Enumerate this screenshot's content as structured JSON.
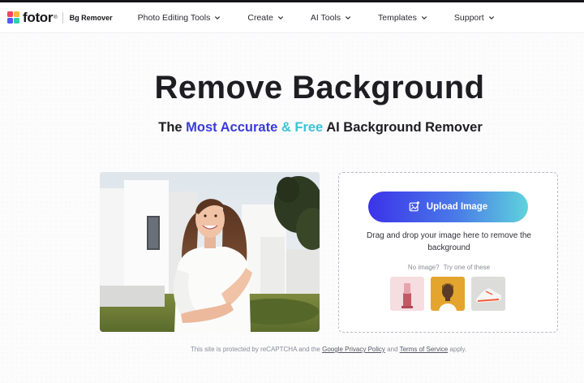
{
  "brand": {
    "logo_text": "fotor",
    "logo_reg": "®",
    "product": "Bg Remover",
    "logo_colors": [
      "#f5455c",
      "#ffb43a",
      "#4f5bff",
      "#2ed3a6"
    ]
  },
  "nav": {
    "items": [
      {
        "label": "Photo Editing Tools",
        "icon": "chevron-down-icon"
      },
      {
        "label": "Create",
        "icon": "chevron-down-icon"
      },
      {
        "label": "AI Tools",
        "icon": "chevron-down-icon"
      },
      {
        "label": "Templates",
        "icon": "chevron-down-icon"
      },
      {
        "label": "Support",
        "icon": "chevron-down-icon"
      }
    ]
  },
  "hero": {
    "title": "Remove Background",
    "subtitle": {
      "part1": "The ",
      "part2": "Most Accurate",
      "part3": " & ",
      "part4": "Free",
      "part5": " AI Background Remover"
    }
  },
  "upload": {
    "button_label": "Upload Image",
    "button_icon": "image-upload-icon",
    "drag_text": "Drag and drop your image here to remove the background",
    "no_image": "No image?",
    "try_text": "Try one of these",
    "samples": [
      {
        "name": "lipstick"
      },
      {
        "name": "woman-portrait"
      },
      {
        "name": "sneaker"
      }
    ]
  },
  "footer": {
    "text1": "This site is protected by reCAPTCHA and the",
    "privacy_link": "Google Privacy Policy",
    "text2": "and",
    "terms_link": "Terms of Service",
    "text3": "apply."
  },
  "colors": {
    "accent_blue": "#3a3bd9",
    "accent_cyan": "#3bc3d3",
    "button_gradient": [
      "#3b33e9",
      "#5fd3dc"
    ]
  }
}
